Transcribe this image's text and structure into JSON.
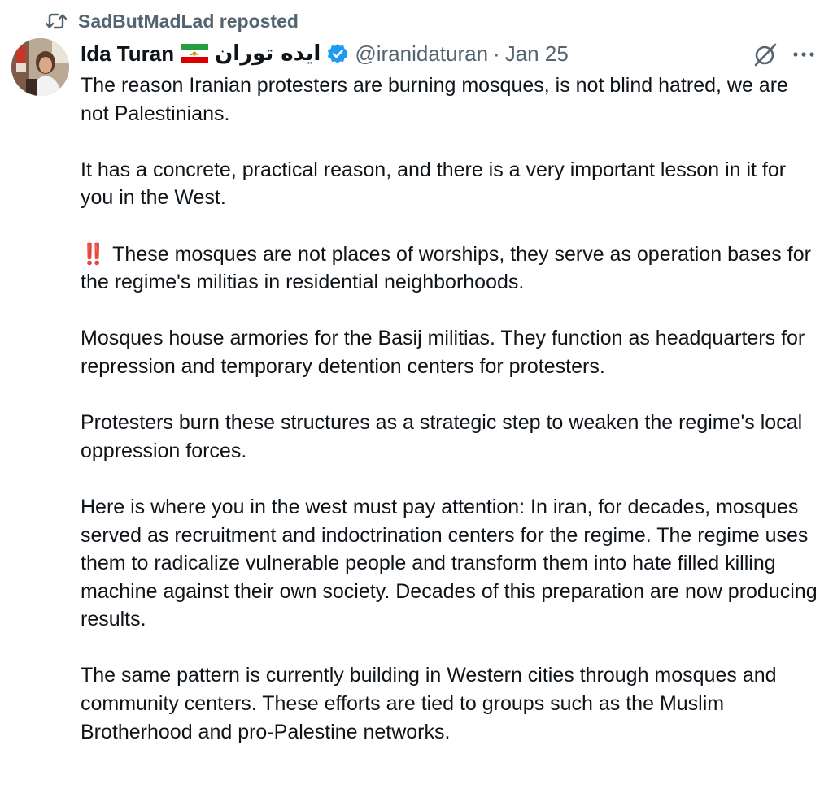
{
  "repost": {
    "icon": "repost-icon",
    "text": "SadButMadLad reposted"
  },
  "author": {
    "display_name": "Ida Turan",
    "flag_icon": "iran-lion-sun-flag-icon",
    "persian_name": "ایده توران",
    "verified_icon": "verified-badge-icon",
    "handle": "@iranidaturan",
    "separator": "·",
    "date": "Jan 25"
  },
  "actions": {
    "grok_icon": "grok-icon",
    "more_icon": "more-options-icon"
  },
  "post": {
    "paragraphs": [
      "The reason Iranian protesters are burning mosques, is not blind hatred, we are not Palestinians.",
      "It has a concrete, practical reason, and there is a very important lesson in it for you in the West.",
      "These mosques are not places of worships, they serve as operation bases for the regime's militias in residential neighborhoods.",
      "Mosques house armories for the Basij militias. They function as headquarters for repression and temporary detention centers for protesters.",
      "Protesters burn these structures as a strategic step to weaken the regime's local oppression forces.",
      "Here is where you in the west must pay attention: In iran, for decades, mosques served as recruitment and indoctrination centers for the regime. The regime uses them to radicalize vulnerable people and transform them into hate filled killing machine against their own society. Decades of this preparation are now producing results.",
      "The same pattern is currently building in Western cities through mosques and community centers. These efforts are tied to groups such as the Muslim Brotherhood and pro-Palestine networks."
    ],
    "emphasis_emoji": "‼️",
    "emphasis_color": "#d2202c"
  },
  "colors": {
    "text": "#0f1419",
    "secondary": "#536471",
    "verified": "#1d9bf0"
  }
}
